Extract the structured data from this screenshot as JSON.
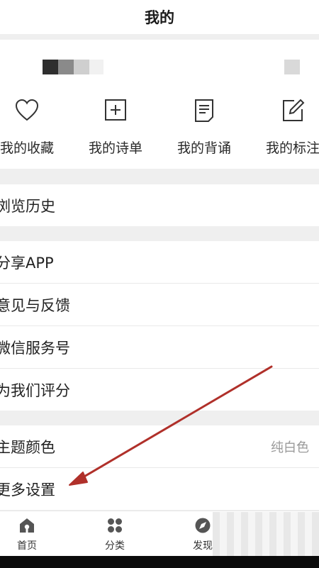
{
  "header": {
    "title": "我的"
  },
  "quick_actions": [
    {
      "label": "我的收藏",
      "icon": "heart-icon"
    },
    {
      "label": "我的诗单",
      "icon": "plus-box-icon"
    },
    {
      "label": "我的背诵",
      "icon": "document-icon"
    },
    {
      "label": "我的标注",
      "icon": "edit-icon"
    }
  ],
  "section_history": [
    {
      "label": "浏览历史"
    }
  ],
  "section_misc": [
    {
      "label": "分享APP"
    },
    {
      "label": "意见与反馈"
    },
    {
      "label": "微信服务号"
    },
    {
      "label": "为我们评分"
    }
  ],
  "section_settings": [
    {
      "label": "主题颜色",
      "value": "纯白色"
    },
    {
      "label": "更多设置"
    }
  ],
  "tabbar": [
    {
      "label": "首页",
      "icon": "home-icon"
    },
    {
      "label": "分类",
      "icon": "category-icon"
    },
    {
      "label": "发现",
      "icon": "compass-icon"
    }
  ],
  "annotation": {
    "color": "#b0302a"
  }
}
